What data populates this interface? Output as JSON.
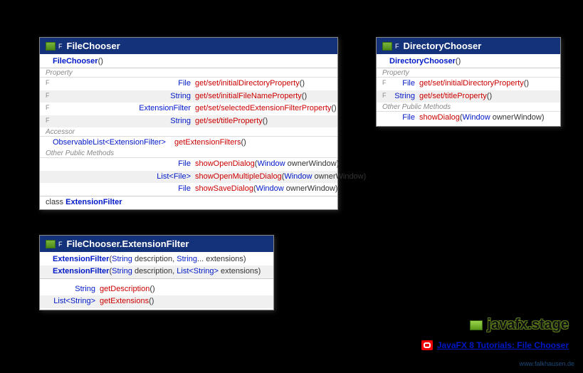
{
  "package": "javafx.stage",
  "tutorial_label": "JavaFX 8 Tutorials: File Chooser",
  "credit": "www.falkhausen.de",
  "fc": {
    "title": "FileChooser",
    "ctor": "FileChooser",
    "sect_property": "Property",
    "sect_accessor": "Accessor",
    "sect_other": "Other Public Methods",
    "prop1_ret": "File",
    "prop1_name": "get/set/initialDirectoryProperty",
    "prop2_ret": "String",
    "prop2_name": "get/set/initialFileNameProperty",
    "prop3_ret": "ExtensionFilter",
    "prop3_name": "get/set/selectedExtensionFilterProperty",
    "prop4_ret": "String",
    "prop4_name": "get/set/titleProperty",
    "acc1_ret": "ObservableList<ExtensionFilter>",
    "acc1_name": "getExtensionFilters",
    "m1_ret": "File",
    "m1_name": "showOpenDialog",
    "m1_ptype": "Window",
    "m1_pname": " ownerWindow",
    "m2_ret": "List<File>",
    "m2_name": "showOpenMultipleDialog",
    "m2_ptype": "Window",
    "m2_pname": " ownerWindow",
    "m3_ret": "File",
    "m3_name": "showSaveDialog",
    "m3_ptype": "Window",
    "m3_pname": " ownerWindow",
    "inner_kw": "class ",
    "inner_name": "ExtensionFilter"
  },
  "dc": {
    "title": "DirectoryChooser",
    "ctor": "DirectoryChooser",
    "sect_property": "Property",
    "sect_other": "Other Public Methods",
    "prop1_ret": "File",
    "prop1_name": "get/set/initialDirectoryProperty",
    "prop2_ret": "String",
    "prop2_name": "get/set/titleProperty",
    "m1_ret": "File",
    "m1_name": "showDialog",
    "m1_ptype": "Window",
    "m1_pname": " ownerWindow"
  },
  "ef": {
    "title": "FileChooser.ExtensionFilter",
    "ctor1_name": "ExtensionFilter",
    "ctor1_p1t": "String",
    "ctor1_p1n": " description, ",
    "ctor1_p2t": "String",
    "ctor1_p2n": "... extensions",
    "ctor2_name": "ExtensionFilter",
    "ctor2_p1t": "String",
    "ctor2_p1n": " description, ",
    "ctor2_p2t": "List<String>",
    "ctor2_p2n": " extensions",
    "m1_ret": "String",
    "m1_name": "getDescription",
    "m2_ret": "List<String>",
    "m2_name": "getExtensions"
  }
}
